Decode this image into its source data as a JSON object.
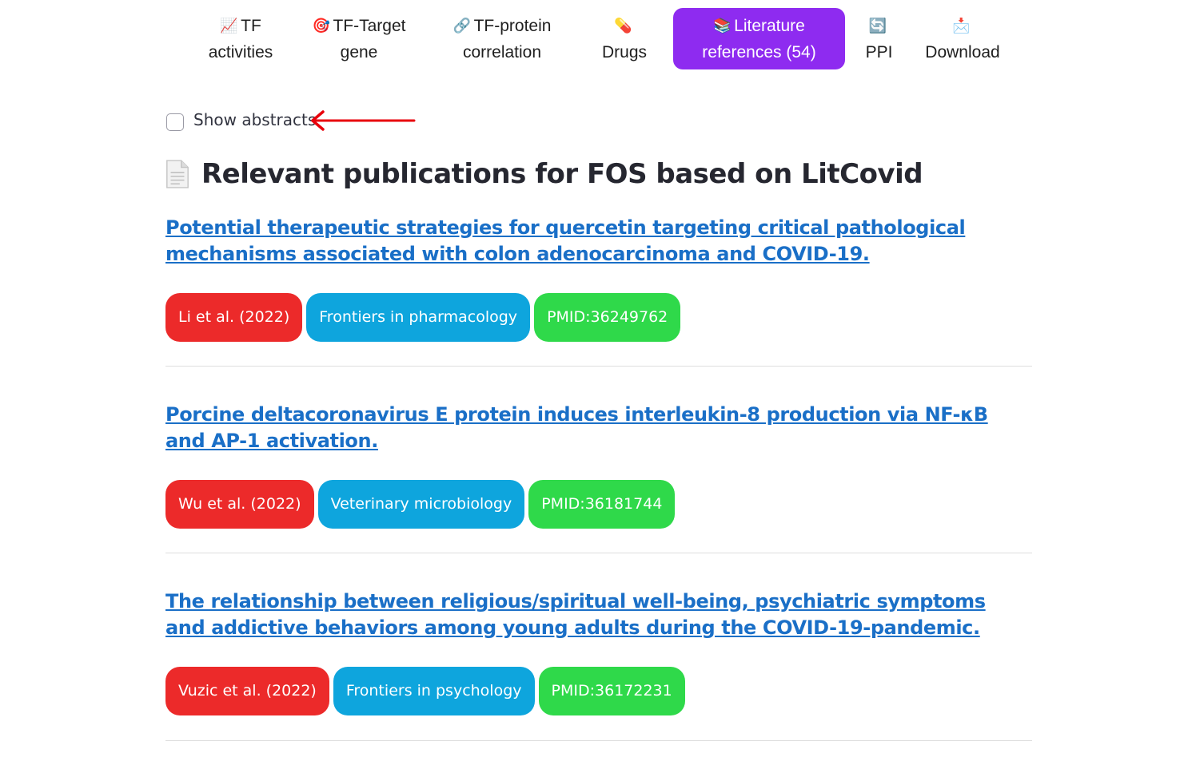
{
  "tabs": [
    {
      "icon": "📈",
      "line1": "TF",
      "line2": "activities",
      "active": false
    },
    {
      "icon": "🎯",
      "line1": "TF-Target",
      "line2": "gene",
      "active": false
    },
    {
      "icon": "🔗",
      "line1": "TF-protein",
      "line2": "correlation",
      "active": false
    },
    {
      "icon": "💊",
      "line1": "",
      "line2": "Drugs",
      "active": false
    },
    {
      "icon": "📚",
      "line1": "Literature",
      "line2": "references (54)",
      "active": true
    },
    {
      "icon": "🔄",
      "line1": "",
      "line2": "PPI",
      "active": false
    },
    {
      "icon": "📩",
      "line1": "",
      "line2": "Download",
      "active": false
    }
  ],
  "abstract_toggle": {
    "label": "Show abstracts",
    "checked": false
  },
  "page_title": "Relevant publications for FOS based on LitCovid",
  "publications": [
    {
      "title": "Potential therapeutic strategies for quercetin targeting critical pathological mechanisms associated with colon adenocarcinoma and COVID-19.",
      "author": "Li et al. (2022)",
      "journal": "Frontiers in pharmacology",
      "pmid": "PMID:36249762"
    },
    {
      "title": "Porcine deltacoronavirus E protein induces interleukin-8 production via NF-κB and AP-1 activation.",
      "author": "Wu et al. (2022)",
      "journal": "Veterinary microbiology",
      "pmid": "PMID:36181744"
    },
    {
      "title": "The relationship between religious/spiritual well-being, psychiatric symptoms and addictive behaviors among young adults during the COVID-19-pandemic.",
      "author": "Vuzic et al. (2022)",
      "journal": "Frontiers in psychology",
      "pmid": "PMID:36172231"
    }
  ],
  "colors": {
    "active_tab": "#8e2bf0",
    "author_badge": "#ec2a2a",
    "journal_badge": "#0ea5dd",
    "pmid_badge": "#2fd94a",
    "link": "#1a6fc7",
    "arrow": "#e8000b"
  },
  "icons": {
    "doc": "document-icon",
    "arrow": "red-arrow-icon"
  }
}
